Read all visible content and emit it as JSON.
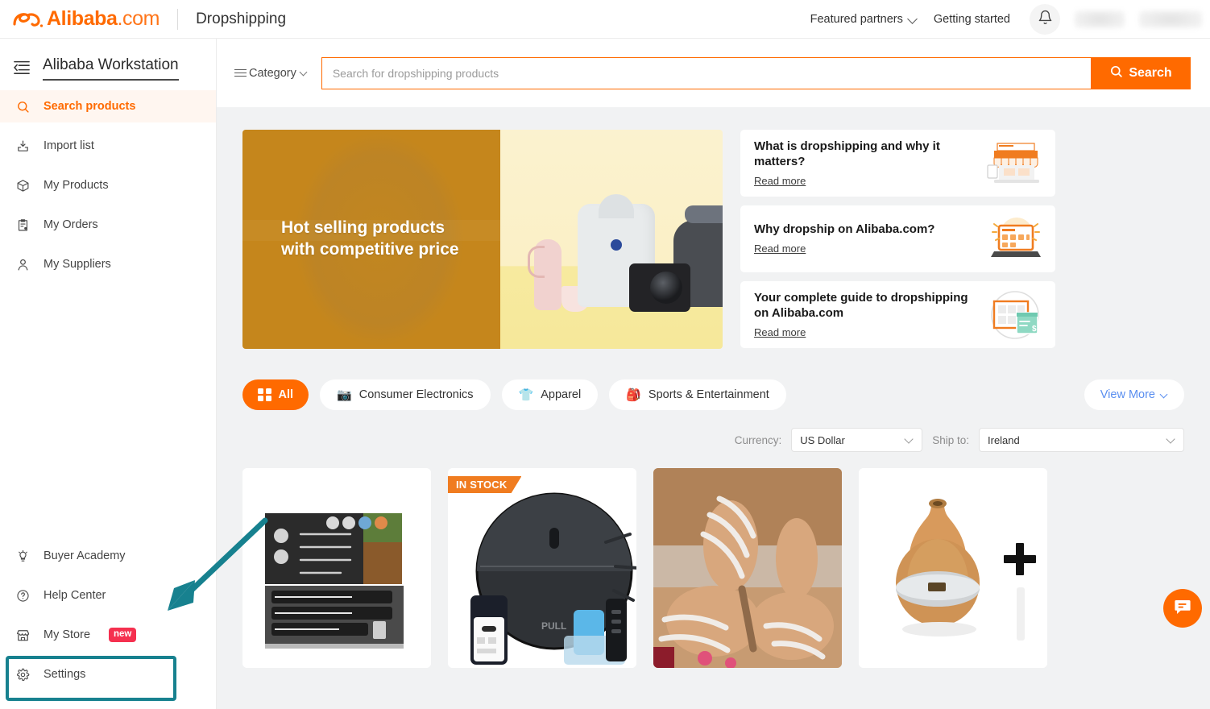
{
  "header": {
    "brand": "Alibaba",
    "brand_suffix": ".com",
    "app_name": "Dropshipping",
    "featured_partners": "Featured partners",
    "getting_started": "Getting started",
    "bell_icon": "bell-icon"
  },
  "sidebar": {
    "workstation_title": "Alibaba Workstation",
    "collapse_icon": "collapse-sidebar-icon",
    "items": [
      {
        "label": "Search products",
        "icon": "search-icon",
        "active": true
      },
      {
        "label": "Import list",
        "icon": "import-tray-icon",
        "active": false
      },
      {
        "label": "My Products",
        "icon": "box-icon",
        "active": false
      },
      {
        "label": "My Orders",
        "icon": "clipboard-icon",
        "active": false
      },
      {
        "label": "My Suppliers",
        "icon": "person-icon",
        "active": false
      }
    ],
    "bottom_items": [
      {
        "label": "Buyer Academy",
        "icon": "lightbulb-icon",
        "badge": ""
      },
      {
        "label": "Help Center",
        "icon": "question-circle-icon",
        "badge": ""
      },
      {
        "label": "My Store",
        "icon": "storefront-icon",
        "badge": "new"
      },
      {
        "label": "Settings",
        "icon": "gear-icon",
        "badge": ""
      }
    ],
    "highlight_color": "#17818f",
    "badge_color": "#f5304f"
  },
  "search": {
    "category_label": "Category",
    "category_icon": "hamburger-lines-icon",
    "placeholder": "Search for dropshipping products",
    "value": "",
    "button_label": "Search",
    "button_icon": "search-icon",
    "accent": "#ff6a00"
  },
  "hero": {
    "title_line1": "Hot selling products",
    "title_line2": "with competitive price"
  },
  "info_cards": [
    {
      "title": "What is dropshipping and why it matters?",
      "link": "Read more",
      "art": "storefront-laptop-illustration"
    },
    {
      "title": "Why dropship on Alibaba.com?",
      "link": "Read more",
      "art": "laptop-globe-illustration"
    },
    {
      "title": "Your complete guide to dropshipping on Alibaba.com",
      "link": "Read more",
      "art": "guide-document-illustration"
    }
  ],
  "categories": [
    {
      "label": "All",
      "icon": "grid-icon",
      "active": true
    },
    {
      "label": "Consumer Electronics",
      "icon": "camera-icon",
      "active": false
    },
    {
      "label": "Apparel",
      "icon": "tshirt-icon",
      "active": false
    },
    {
      "label": "Sports & Entertainment",
      "icon": "backpack-icon",
      "active": false
    }
  ],
  "view_more": {
    "label": "View More",
    "icon": "chevron-down-icon",
    "color": "#5b8ff0"
  },
  "selectors": {
    "currency_label": "Currency:",
    "currency_value": "US Dollar",
    "shipto_label": "Ship to:",
    "shipto_value": "Ireland"
  },
  "products": [
    {
      "name": "knife-set",
      "badge": ""
    },
    {
      "name": "robot-vacuum",
      "badge": "IN STOCK"
    },
    {
      "name": "rhinestone-sandals",
      "badge": ""
    },
    {
      "name": "aroma-diffuser",
      "badge": ""
    }
  ],
  "chat": {
    "icon": "chat-bubble-icon",
    "color": "#ff6a00"
  }
}
